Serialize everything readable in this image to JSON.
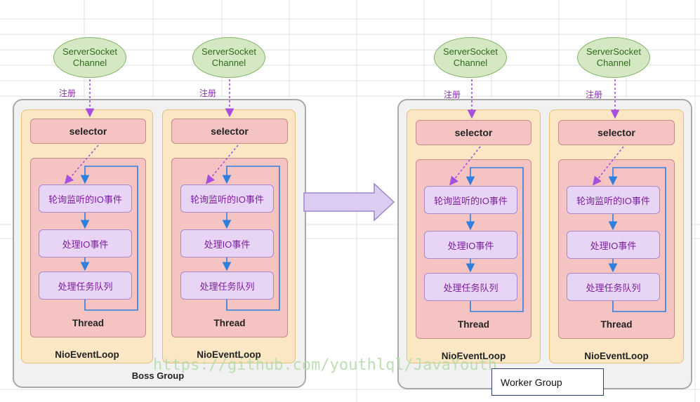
{
  "boss_group": {
    "label": "Boss Group",
    "loops": [
      {
        "channel_line1": "ServerSocket",
        "channel_line2": "Channel",
        "register_label": "注册",
        "selector_label": "selector",
        "steps": [
          "轮询监听的IO事件",
          "处理IO事件",
          "处理任务队列"
        ],
        "thread_label": "Thread",
        "loop_label": "NioEventLoop"
      },
      {
        "channel_line1": "ServerSocket",
        "channel_line2": "Channel",
        "register_label": "注册",
        "selector_label": "selector",
        "steps": [
          "轮询监听的IO事件",
          "处理IO事件",
          "处理任务队列"
        ],
        "thread_label": "Thread",
        "loop_label": "NioEventLoop"
      }
    ]
  },
  "worker_group": {
    "label": "Worker Group",
    "loops": [
      {
        "channel_line1": "ServerSocket",
        "channel_line2": "Channel",
        "register_label": "注册",
        "selector_label": "selector",
        "steps": [
          "轮询监听的IO事件",
          "处理IO事件",
          "处理任务队列"
        ],
        "thread_label": "Thread",
        "loop_label": "NioEventLoop"
      },
      {
        "channel_line1": "ServerSocket",
        "channel_line2": "Channel",
        "register_label": "注册",
        "selector_label": "selector",
        "steps": [
          "轮询监听的IO事件",
          "处理IO事件",
          "处理任务队列"
        ],
        "thread_label": "Thread",
        "loop_label": "NioEventLoop"
      }
    ]
  },
  "watermark": "https://github.com/youthlql/JavaYouth",
  "colors": {
    "channel_fill": "#d5e8c4",
    "loop_fill": "#fbe7c4",
    "selector_fill": "#f6c3c3",
    "step_fill": "#e8d5f5",
    "step_text": "#7a1f9b",
    "arrow_fill": "#dccdf2",
    "flow_arrow": "#2f7fdc",
    "register_arrow": "#a64ee0"
  }
}
